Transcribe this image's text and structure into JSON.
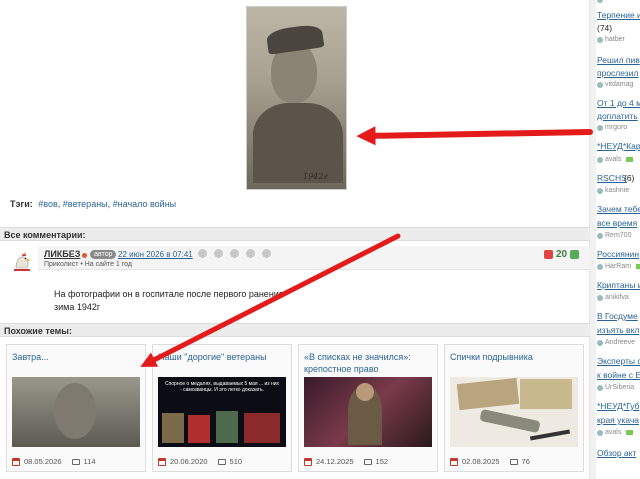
{
  "post": {
    "photo_signature": "1942г",
    "tags_label": "Тэги:",
    "tags": [
      "#вов",
      "#ветераны",
      "#начало войны"
    ]
  },
  "comments": {
    "header": "Все комментарии:",
    "items": [
      {
        "author": "ЛИКБЕЗ",
        "role_badge": "автор",
        "date": "22 июн 2026 в 07:41",
        "status": "Приколист  •  На сайте 1 год",
        "rating": "20",
        "text_line1": "На фотографии он в госпитале после первого ранения",
        "text_line2": "зима 1942г"
      }
    ]
  },
  "similar": {
    "header": "Похожие темы:",
    "cards": [
      {
        "title": "Завтра...",
        "date": "08.05.2026",
        "comments": "114"
      },
      {
        "title": "Наши \"дорогие\" ветераны",
        "date": "20.06.2020",
        "comments": "510",
        "img_caption": "Спорное о медалях, выдаваемых 5 мая ... из них - самозванцы. И это легко доказать."
      },
      {
        "title": "«В списках не значился»: крепостное право",
        "date": "24.12.2025",
        "comments": "152"
      },
      {
        "title": "Спички подрывника",
        "date": "02.08.2025",
        "comments": "76"
      }
    ]
  },
  "sidebar": {
    "items": [
      {
        "title": "Терпение и",
        "count": "(74)",
        "user": "hatber"
      },
      {
        "title": "Решил пив",
        "title2": "прослезил",
        "user": "vitdamag"
      },
      {
        "title": "От 1 до 4 м",
        "title2": "доплатить",
        "user": "mrgoro"
      },
      {
        "title": "*НЕУД*Кар",
        "user": "avals"
      },
      {
        "title": "RSCHS",
        "count": "(6)",
        "user": "kashnie"
      },
      {
        "title": "Зачем тебе",
        "title2": "все время",
        "user": "Rem700"
      },
      {
        "title": "Россиянин",
        "user": "HarRam"
      },
      {
        "title": "Криптаны и",
        "user": "anikifva"
      },
      {
        "title": "В Госдуме",
        "title2": "изъять вкл",
        "user": "Andreeve"
      },
      {
        "title": "Эксперты с",
        "title2": "к войне с Е",
        "user": "UrSiberia"
      },
      {
        "title": "*НЕУД*Губ",
        "title2": "края укача",
        "user": "avals"
      },
      {
        "title": "Обзор акт"
      }
    ]
  },
  "colors": {
    "link": "#2a6496",
    "arrow": "#e31b1b",
    "rating_green": "#3b7f3b"
  }
}
